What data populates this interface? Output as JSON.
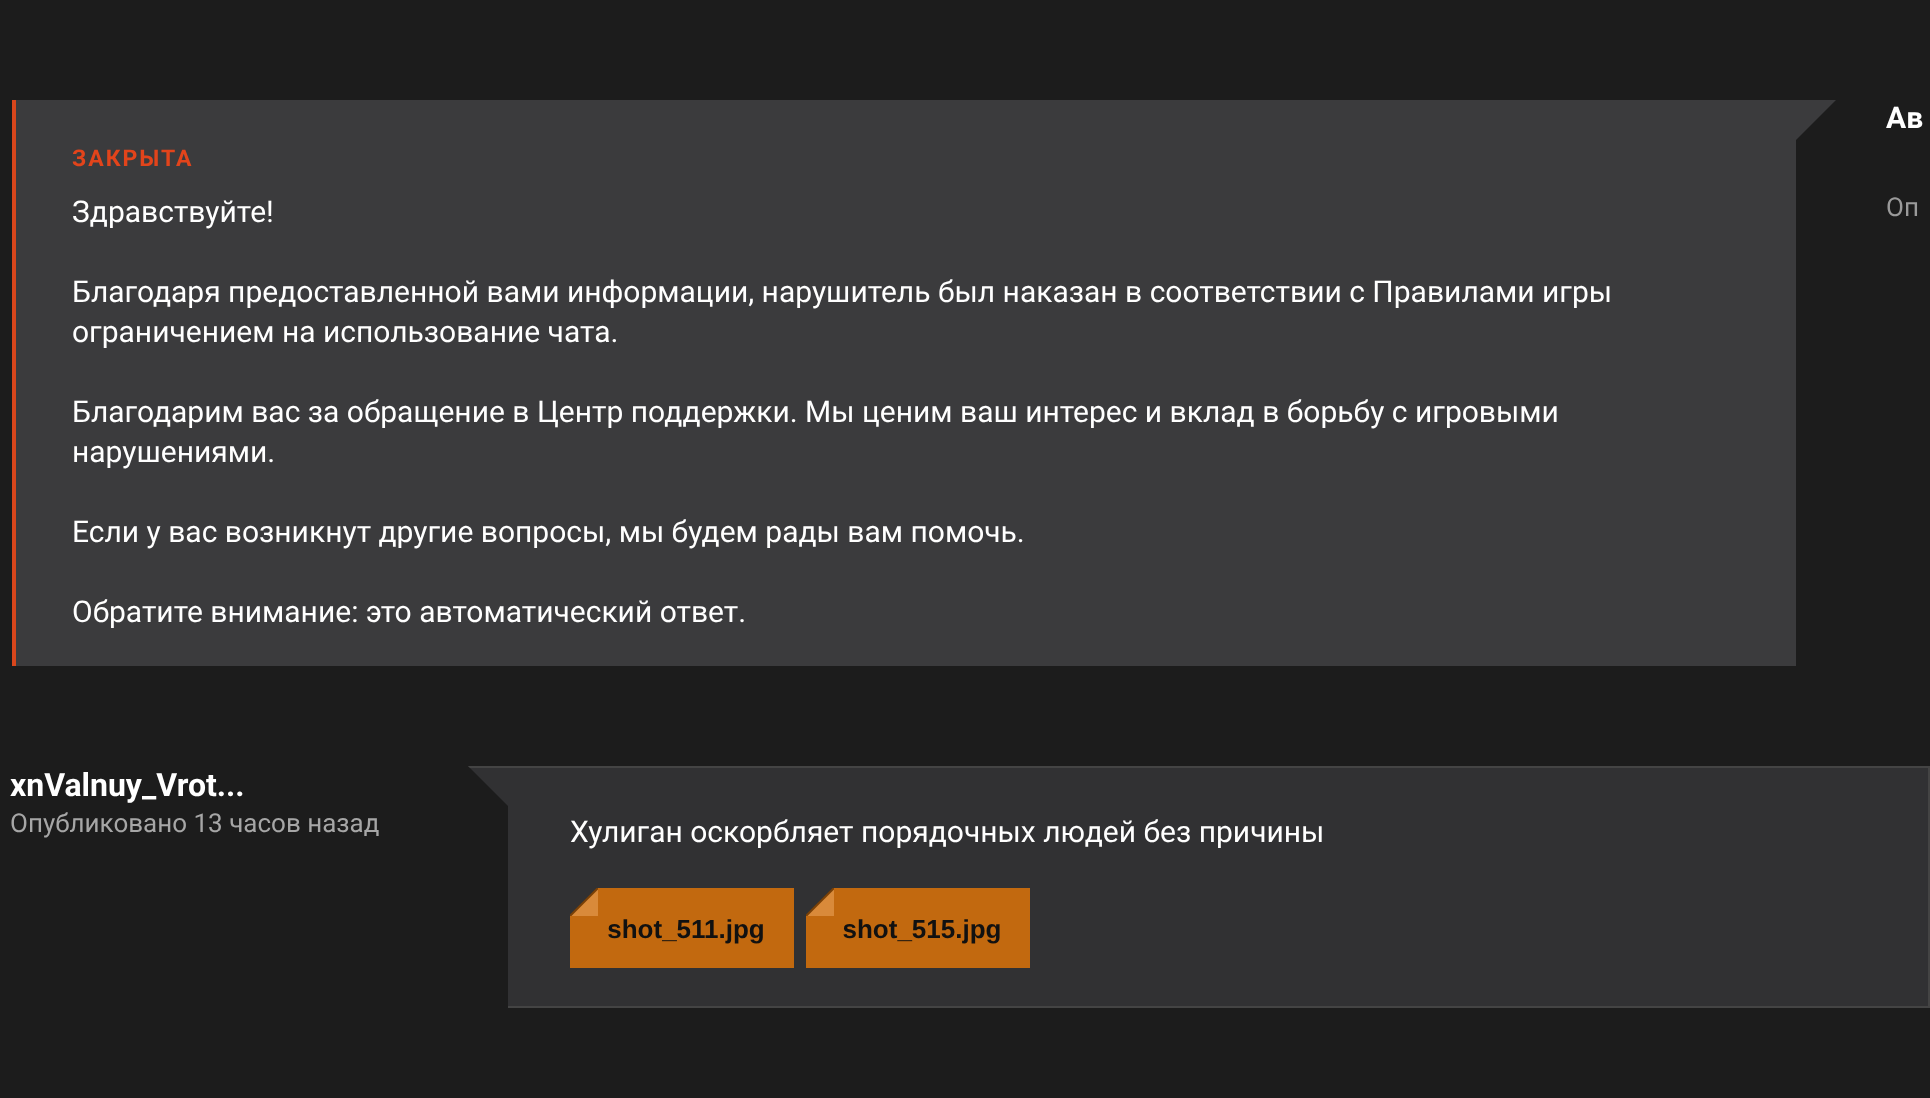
{
  "ticket": {
    "status": "ЗАКРЫТА",
    "paragraphs": [
      "Здравствуйте!",
      "Благодаря предоставленной вами информации, нарушитель был наказан в соответствии с Правилами игры ограничением на использование чата.",
      "Благодарим вас за обращение в Центр поддержки. Мы ценим ваш интерес и вклад в борьбу с игровыми нарушениями.",
      "Если у вас возникнут другие вопросы, мы будем рады вам помочь.",
      "Обратите внимание: это автоматический ответ."
    ]
  },
  "side_author": {
    "name": "Ав",
    "meta": "Оп"
  },
  "message": {
    "author": "xnValnuy_Vrot...",
    "meta": "Опубликовано 13 часов назад",
    "text": "Хулиган оскорбляет порядочных людей без причины",
    "attachments": [
      "shot_511.jpg",
      "shot_515.jpg"
    ]
  }
}
